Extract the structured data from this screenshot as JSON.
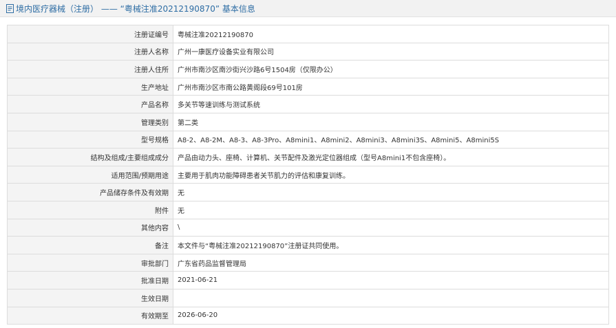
{
  "header": {
    "icon": "document-icon",
    "title": "境内医疗器械（注册） —— “粤械注准20212190870” 基本信息"
  },
  "rows": [
    {
      "label": "注册证编号",
      "value": "粤械注准20212190870"
    },
    {
      "label": "注册人名称",
      "value": "广州一康医疗设备实业有限公司"
    },
    {
      "label": "注册人住所",
      "value": "广州市南沙区南沙街兴沙路6号1504房（仅限办公）"
    },
    {
      "label": "生产地址",
      "value": "广州市南沙区市南公路黄阁段69号101房"
    },
    {
      "label": "产品名称",
      "value": "多关节等速训练与测试系统"
    },
    {
      "label": "管理类别",
      "value": "第二类"
    },
    {
      "label": "型号规格",
      "value": "A8-2、A8-2M、A8-3、A8-3Pro、A8mini1、A8mini2、A8mini3、A8mini3S、A8mini5、A8mini5S"
    },
    {
      "label": "结构及组成/主要组成成分",
      "value": "产品由动力头、座椅、计算机、关节配件及激光定位器组成（型号A8mini1不包含座椅）。"
    },
    {
      "label": "适用范围/预期用途",
      "value": "主要用于肌肉功能障碍患者关节肌力的评估和康复训练。"
    },
    {
      "label": "产品储存条件及有效期",
      "value": "无"
    },
    {
      "label": "附件",
      "value": "无"
    },
    {
      "label": "其他内容",
      "value": "\\"
    },
    {
      "label": "备注",
      "value": "本文件与“粤械注准20212190870”注册证共同使用。"
    },
    {
      "label": "审批部门",
      "value": "广东省药品监督管理局"
    },
    {
      "label": "批准日期",
      "value": "2021-06-21"
    },
    {
      "label": "生效日期",
      "value": ""
    },
    {
      "label": "有效期至",
      "value": "2026-06-20"
    }
  ],
  "colors": {
    "header_bg": "#f2f2f2",
    "title_blue": "#2e6da4",
    "label_bg": "#f4f4f4",
    "border": "#dcdcdc"
  }
}
